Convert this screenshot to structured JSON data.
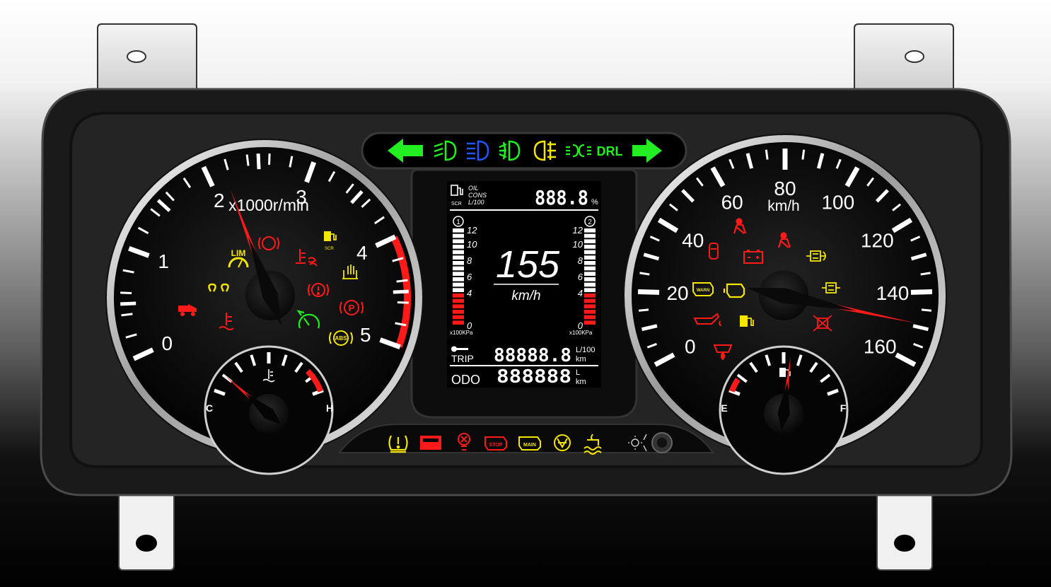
{
  "tachometer": {
    "unit_label": "x1000r/min",
    "scale_labels": [
      "0",
      "1",
      "2",
      "3",
      "4",
      "5"
    ],
    "value": 2.1,
    "max": 5,
    "redline_from": 4
  },
  "speedometer": {
    "unit_label": "km/h",
    "scale_labels": [
      "0",
      "20",
      "40",
      "60",
      "80",
      "100",
      "120",
      "140",
      "160"
    ],
    "value": 149,
    "max": 160
  },
  "coolant_gauge": {
    "low_label": "C",
    "high_label": "H",
    "value": 0.15
  },
  "fuel_gauge": {
    "low_label": "E",
    "high_label": "F",
    "value": 0.55
  },
  "lcd": {
    "oil_label": "OIL",
    "cons_label": "CONS",
    "unit_l100_label": "L/100",
    "scr_label": "SCR",
    "top_value": "888.8",
    "percent_label": "%",
    "speed_value": "155",
    "speed_unit": "km/h",
    "bar1_badge": "1",
    "bar2_badge": "2",
    "bar_ticks": [
      "12",
      "10",
      "8",
      "6",
      "4",
      "0"
    ],
    "bar_unit": "x100KPa",
    "bar1_fill": 0.32,
    "bar2_fill": 0.32,
    "trip_label": "TRIP",
    "trip_value": "88888.8",
    "trip_unit_top": "L/100",
    "trip_unit_bottom": "km",
    "odo_label": "ODO",
    "odo_value": "888888",
    "odo_unit_top": "L",
    "odo_unit_bottom": "km"
  },
  "top_indicators": {
    "drl_label": "DRL"
  },
  "bottom_indicators": {
    "stop_label": "STOP",
    "main_label": "MAIN"
  },
  "tacho_warnings": {
    "lim_label": "LIM",
    "scr_label": "SCR",
    "abs_label": "ABS",
    "p_label": "P"
  },
  "speedo_warnings": {
    "warn_label": "WARN"
  },
  "colors": {
    "red": "#ff1a1a",
    "yellow": "#f5e600",
    "green": "#22ee22",
    "blue": "#2255ff"
  }
}
